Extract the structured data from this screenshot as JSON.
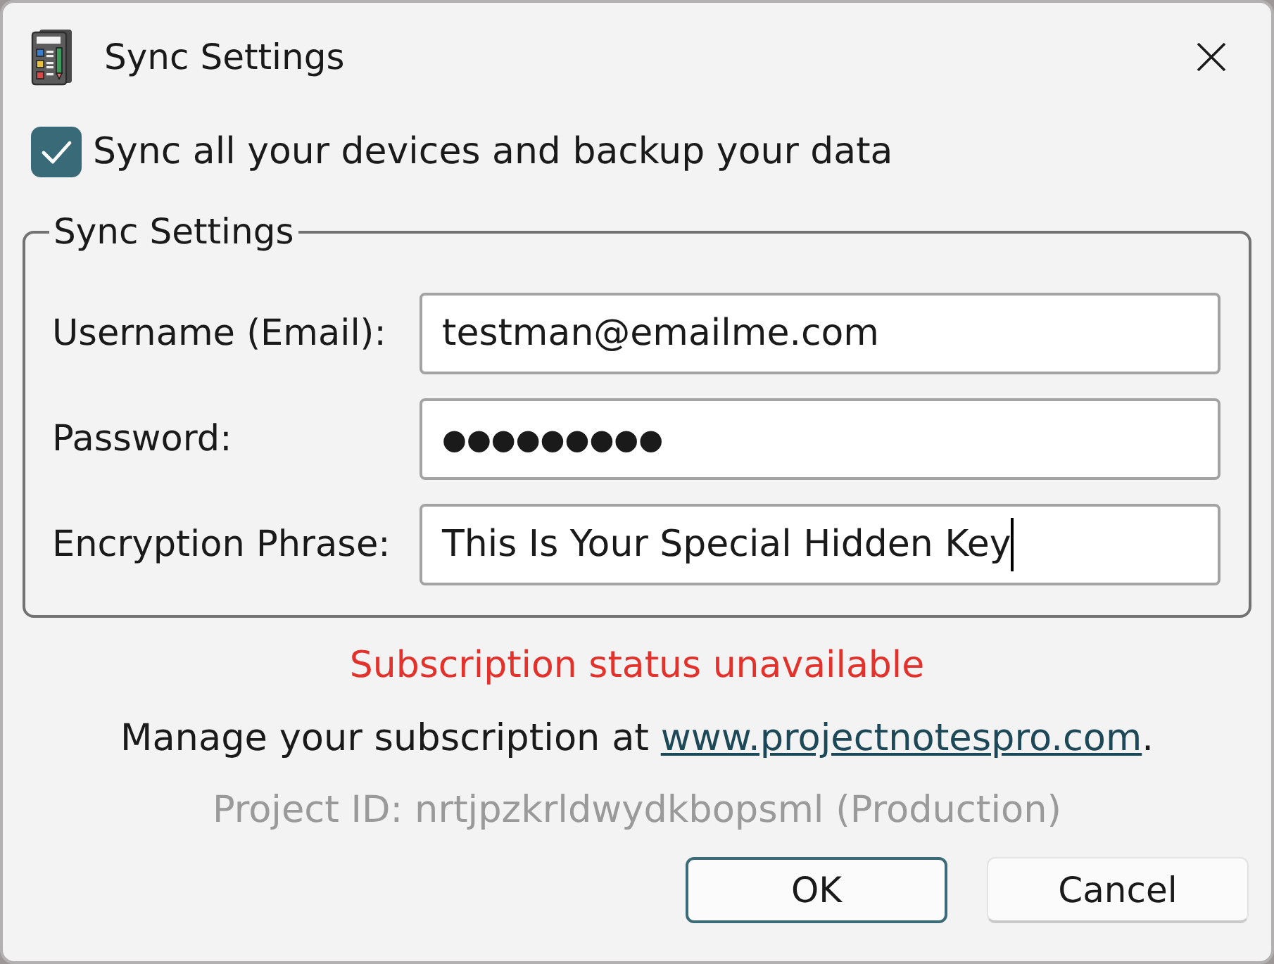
{
  "window": {
    "title": "Sync Settings"
  },
  "sync_checkbox": {
    "label": "Sync all your devices and backup your data",
    "checked": true
  },
  "group": {
    "title": "Sync Settings",
    "fields": [
      {
        "label": "Username (Email):",
        "kind": "text",
        "value": "testman@emailme.com",
        "focused": false
      },
      {
        "label": "Password:",
        "kind": "password",
        "value": "●●●●●●●●●",
        "focused": false
      },
      {
        "label": "Encryption Phrase:",
        "kind": "text",
        "value": "This Is Your Special Hidden Key",
        "focused": true
      }
    ]
  },
  "status": {
    "text": "Subscription status unavailable",
    "kind": "error"
  },
  "manage": {
    "text": "Manage your subscription at ",
    "link": "www.projectnotespro.com",
    "suffix": "."
  },
  "project_id": "Project ID: nrtjpzkrldwydkbopsml (Production)",
  "buttons": [
    {
      "label": "OK",
      "default": true
    },
    {
      "label": "Cancel",
      "default": false
    }
  ]
}
